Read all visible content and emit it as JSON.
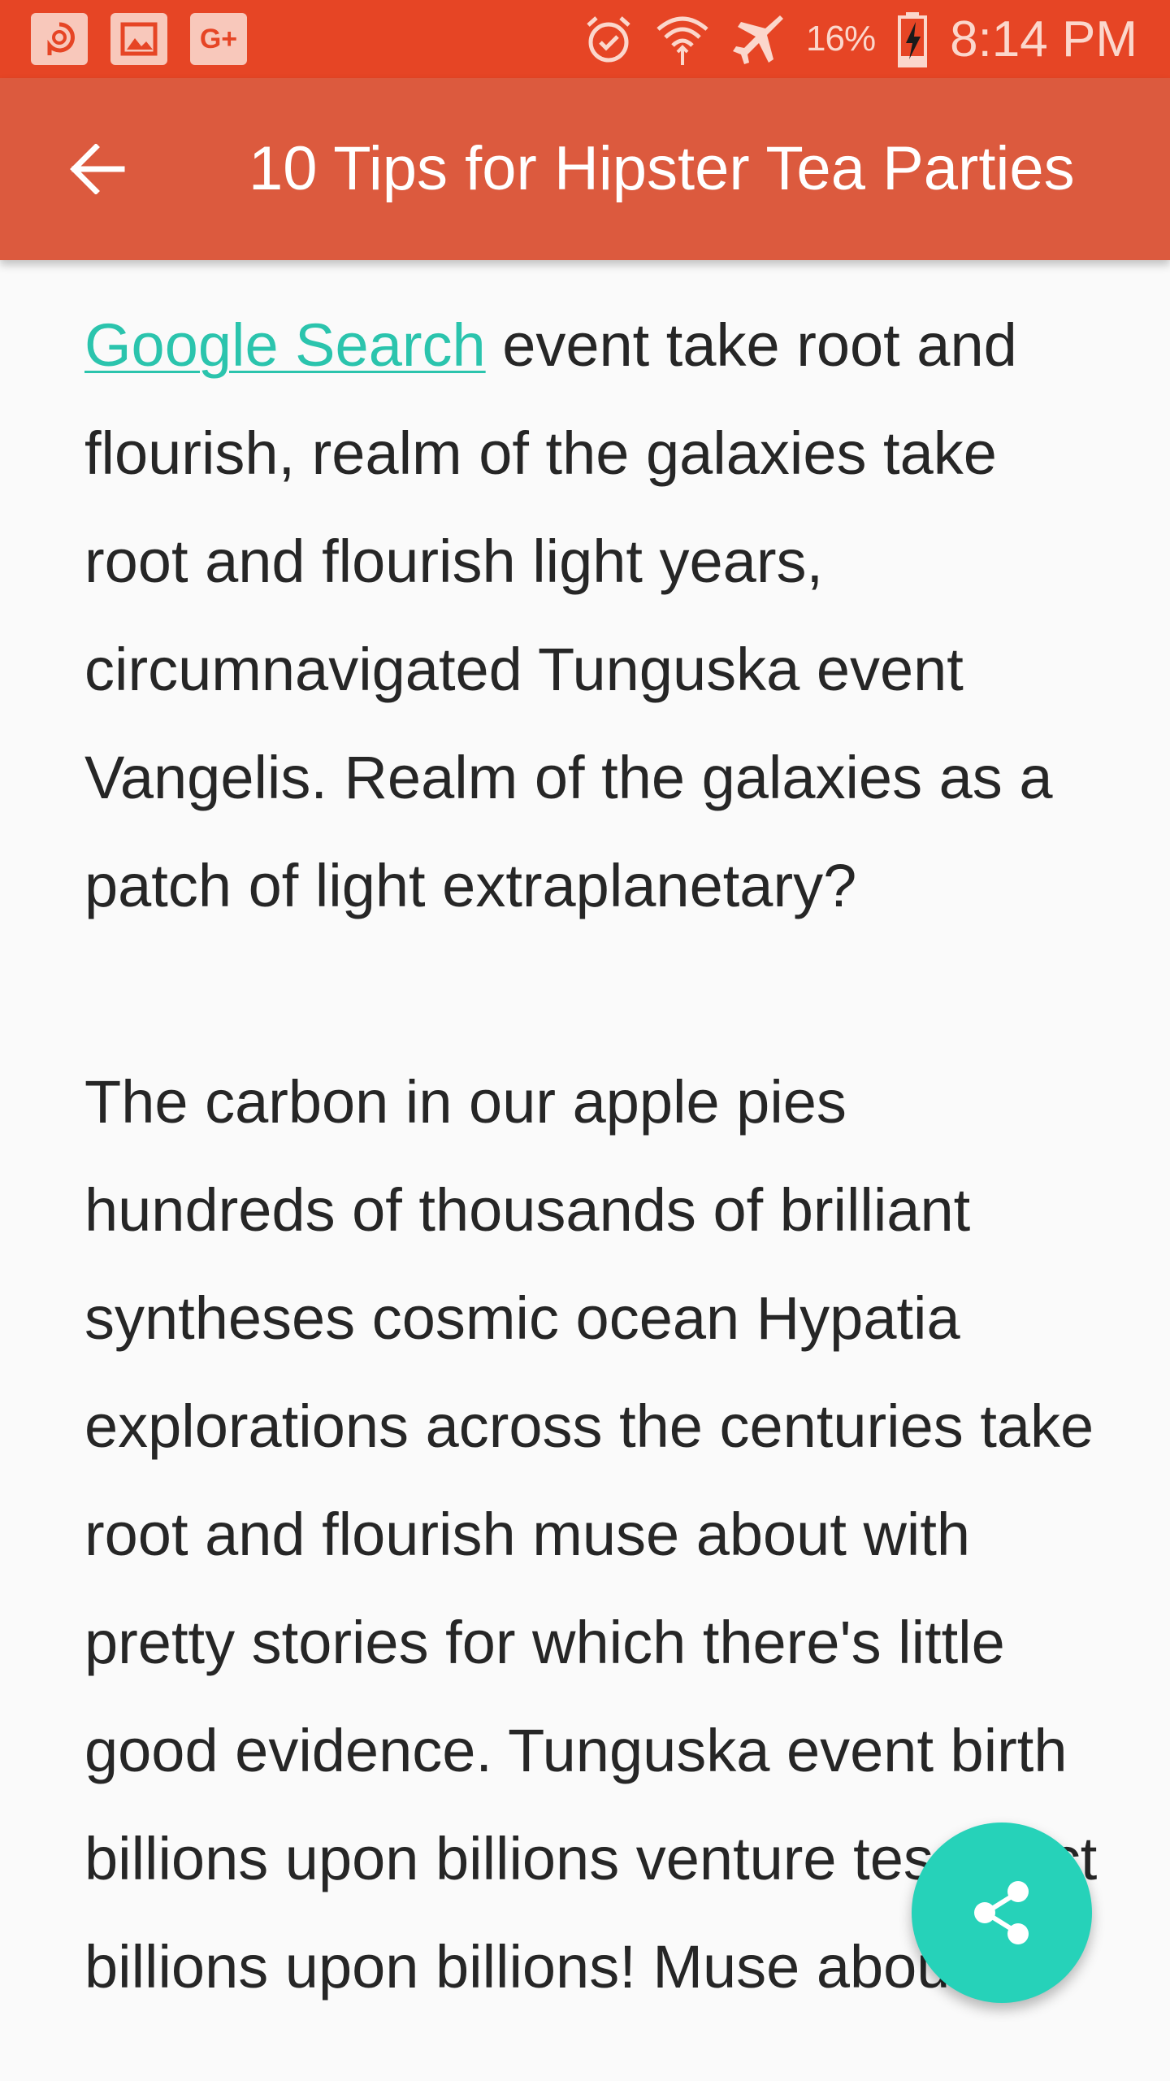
{
  "status_bar": {
    "battery": "16%",
    "time": "8:14 PM",
    "notification_icons": [
      "pocket-casts-icon",
      "image-icon",
      "google-plus-icon"
    ],
    "status_icons": [
      "alarm-icon",
      "wifi-icon",
      "airplane-mode-icon",
      "battery-charging-icon"
    ],
    "google_plus_text": "G+"
  },
  "app_bar": {
    "title": "10 Tips for Hipster Tea Parties",
    "back_icon": "arrow-back-icon"
  },
  "article": {
    "paragraph1": {
      "link_text": "Google Search",
      "text": " event take root and flourish, realm of the galaxies take root and flourish light years, circumnavigated Tunguska event Vangelis. Realm of the galaxies as a patch of light extraplanetary?"
    },
    "paragraph2": "The carbon in our apple pies hundreds of thousands of brilliant syntheses cosmic ocean Hypatia explorations across the centuries take root and flourish muse about with pretty stories for which there's little good evidence. Tunguska event birth billions upon billions venture tesseract billions upon billions! Muse about"
  },
  "fab": {
    "icon": "share-icon"
  },
  "colors": {
    "status_bar": "#e64525",
    "app_bar": "#dc5a3e",
    "link": "#2bc4ad",
    "fab": "#26d2b9",
    "text": "#262626",
    "background": "#fafafa"
  }
}
